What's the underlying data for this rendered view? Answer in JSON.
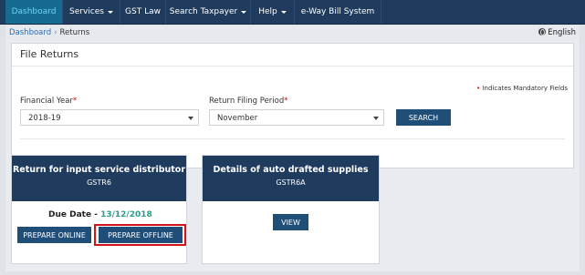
{
  "nav": {
    "items": [
      {
        "label": "Dashboard",
        "active": true,
        "dropdown": false
      },
      {
        "label": "Services",
        "active": false,
        "dropdown": true
      },
      {
        "label": "GST Law",
        "active": false,
        "dropdown": false
      },
      {
        "label": "Search Taxpayer",
        "active": false,
        "dropdown": true
      },
      {
        "label": "Help",
        "active": false,
        "dropdown": true
      },
      {
        "label": "e-Way Bill System",
        "active": false,
        "dropdown": false
      }
    ]
  },
  "breadcrumb": {
    "home": "Dashboard",
    "separator": "›",
    "current": "Returns"
  },
  "language": "English",
  "panel": {
    "title": "File Returns",
    "mandatory_star": "•",
    "mandatory_note": "Indicates Mandatory Fields",
    "financial_year_label": "Financial Year",
    "financial_year_value": "2018-19",
    "period_label": "Return Filing Period",
    "period_value": "November",
    "search_label": "SEARCH"
  },
  "cards": [
    {
      "title": "Return for input service distributor",
      "subtitle": "GSTR6",
      "due_label": "Due Date -",
      "due_value": "13/12/2018",
      "buttons": [
        "PREPARE ONLINE",
        "PREPARE OFFLINE"
      ]
    },
    {
      "title": "Details of auto drafted supplies",
      "subtitle": "GSTR6A",
      "buttons": [
        "VIEW"
      ]
    }
  ],
  "colors": {
    "navbar": "#1f3b5e",
    "active_tab": "#166b92",
    "button": "#1f4e79",
    "due_date": "#2a9d8f",
    "highlight": "#d0121b",
    "required": "#d00000"
  }
}
